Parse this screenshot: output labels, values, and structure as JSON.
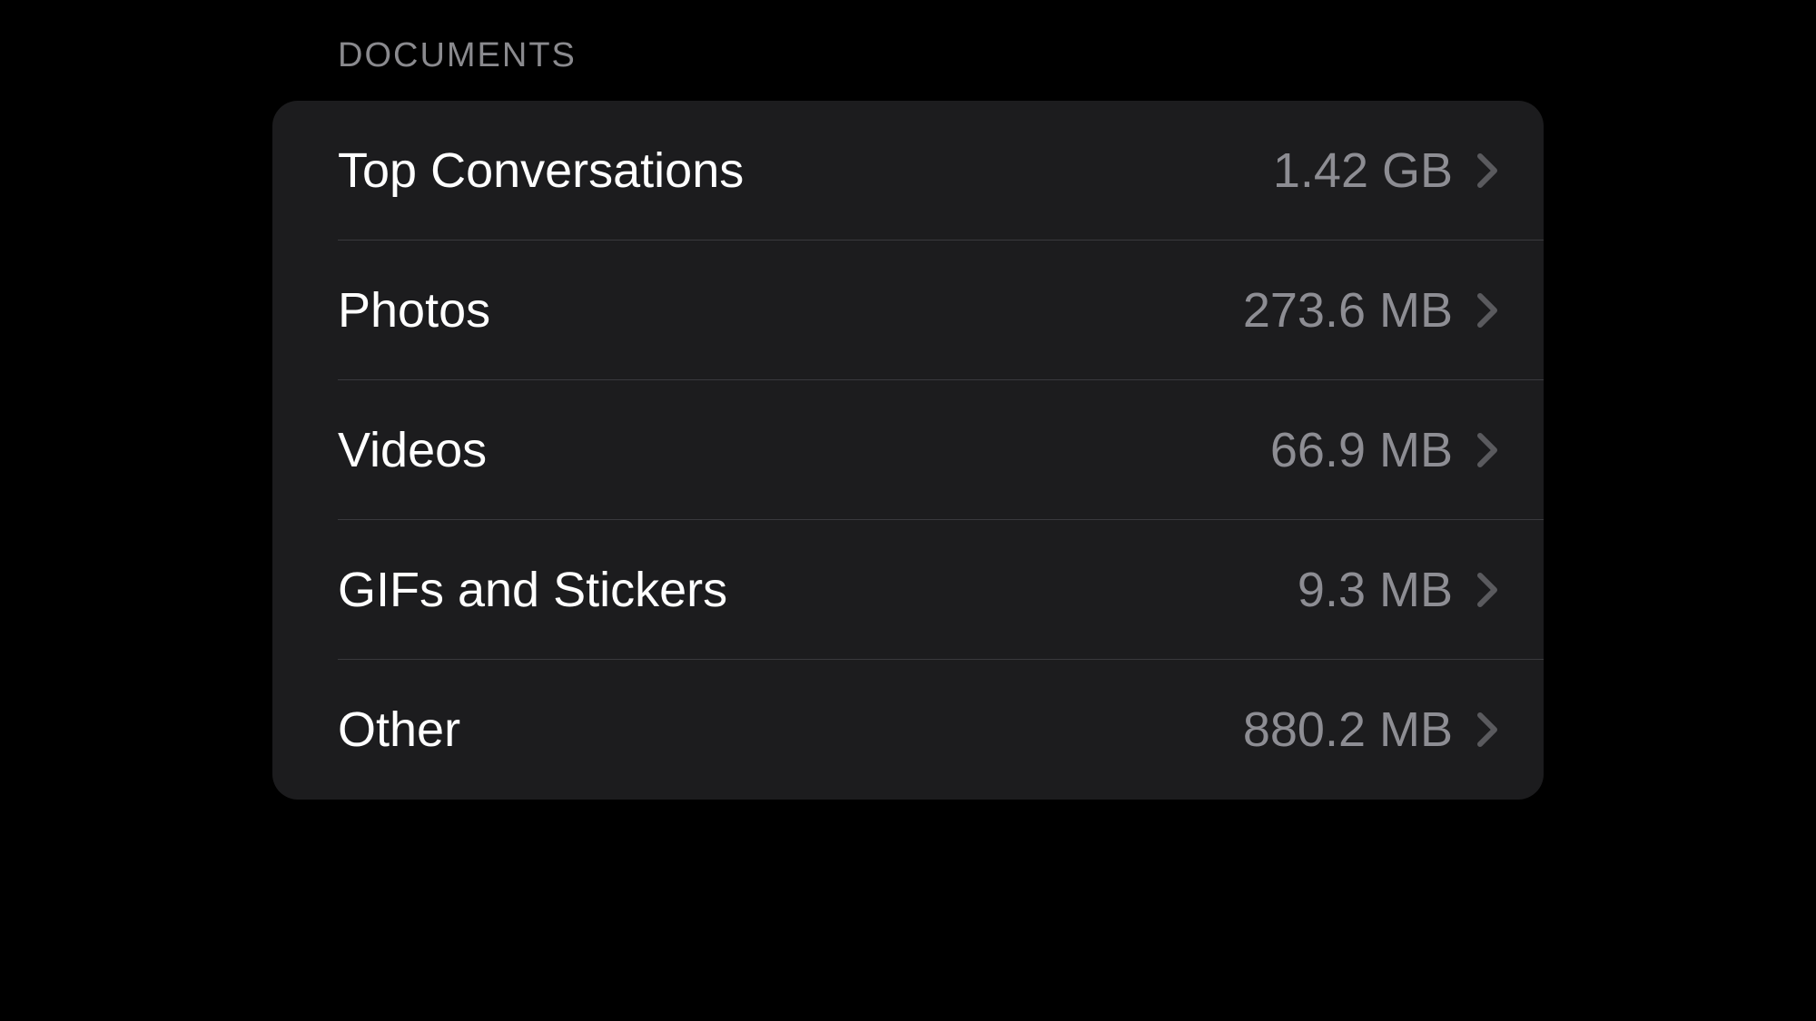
{
  "section": {
    "title": "Documents"
  },
  "items": [
    {
      "label": "Top Conversations",
      "value": "1.42 GB"
    },
    {
      "label": "Photos",
      "value": "273.6 MB"
    },
    {
      "label": "Videos",
      "value": "66.9 MB"
    },
    {
      "label": "GIFs and Stickers",
      "value": "9.3 MB"
    },
    {
      "label": "Other",
      "value": "880.2 MB"
    }
  ]
}
